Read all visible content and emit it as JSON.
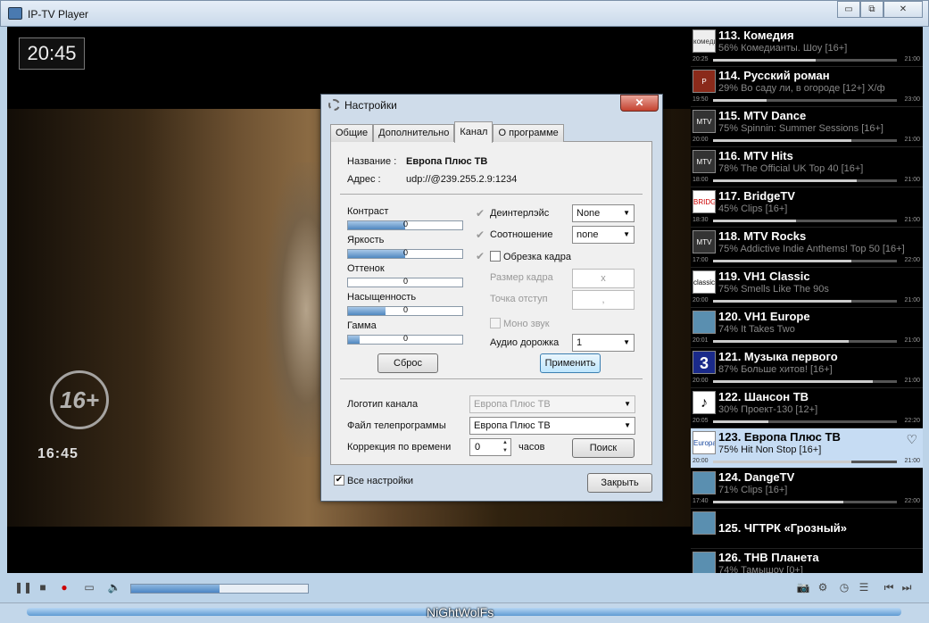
{
  "window": {
    "title": "IP-TV Player",
    "buttons": [
      "▭",
      "⧉",
      "✕"
    ]
  },
  "video": {
    "clock": "20:45",
    "age_rating": "16+",
    "overlay_time": "16:45"
  },
  "channels": [
    {
      "name": "113. Комедия",
      "program": "56% Комедианты. Шоу [16+]",
      "start": "20:25",
      "end": "21:00",
      "progress": 56,
      "logo": "комедия"
    },
    {
      "name": "114. Русский роман",
      "program": "29% Во саду ли, в огороде [12+] Х/ф",
      "start": "19:50",
      "end": "23:00",
      "progress": 29,
      "logo": "P"
    },
    {
      "name": "115. MTV Dance",
      "program": "75% Spinnin: Summer Sessions [16+]",
      "start": "20:00",
      "end": "21:00",
      "progress": 75,
      "logo": "MTV"
    },
    {
      "name": "116. MTV Hits",
      "program": "78% The Official UK Top 40 [16+]",
      "start": "18:00",
      "end": "21:00",
      "progress": 78,
      "logo": "MTV"
    },
    {
      "name": "117. BridgeTV",
      "program": "45% Clips [16+]",
      "start": "18:30",
      "end": "21:00",
      "progress": 45,
      "logo": "BRIDGE"
    },
    {
      "name": "118. MTV Rocks",
      "program": "75% Addictive Indie Anthems! Top 50 [16+]",
      "start": "17:00",
      "end": "22:00",
      "progress": 75,
      "logo": "MTV"
    },
    {
      "name": "119. VH1 Classic",
      "program": "75% Smells Like The 90s",
      "start": "20:00",
      "end": "21:00",
      "progress": 75,
      "logo": "classic"
    },
    {
      "name": "120. VH1 Europe",
      "program": "74% It Takes Two",
      "start": "20:01",
      "end": "21:00",
      "progress": 74,
      "logo": ""
    },
    {
      "name": "121. Музыка первого",
      "program": "87% Больше хитов! [16+]",
      "start": "20:00",
      "end": "21:00",
      "progress": 87,
      "logo": "3"
    },
    {
      "name": "122. Шансон ТВ",
      "program": "30% Проект-130 [12+]",
      "start": "20:05",
      "end": "22:20",
      "progress": 30,
      "logo": "♪"
    },
    {
      "name": "123. Европа Плюс ТВ",
      "program": "75% Hit Non Stop [16+]",
      "start": "20:00",
      "end": "21:00",
      "progress": 75,
      "logo": "Europa"
    },
    {
      "name": "124. DangeTV",
      "program": "71% Clips [16+]",
      "start": "17:40",
      "end": "22:00",
      "progress": 71,
      "logo": ""
    },
    {
      "name": "125. ЧГТРК «Грозный»",
      "program": "",
      "start": "",
      "end": "",
      "progress": 0,
      "logo": ""
    },
    {
      "name": "126. ТНВ Планета",
      "program": "74% Тамышоу [0+]",
      "start": "",
      "end": "",
      "progress": 74,
      "logo": ""
    }
  ],
  "selected_channel_index": 10,
  "controls": {
    "seek_progress": 50,
    "icons": [
      "pause-icon",
      "stop-icon",
      "record-icon",
      "folder-icon",
      "volume-icon",
      "camera-icon",
      "settings-icon",
      "clock-icon",
      "playlist-icon",
      "prev-icon",
      "next-icon"
    ]
  },
  "status": {
    "nickname": "NiGhtWolFs"
  },
  "dialog": {
    "title": "Настройки",
    "close": "✕",
    "tabs": [
      "Общие",
      "Дополнительно",
      "Канал",
      "О программе"
    ],
    "active_tab": 2,
    "name_label": "Название :",
    "name_value": "Европа Плюс ТВ",
    "address_label": "Адрес :",
    "address_value": "udp://@239.255.2.9:1234",
    "sliders": [
      {
        "label": "Контраст",
        "value": "0",
        "fill": 50
      },
      {
        "label": "Яркость",
        "value": "0",
        "fill": 50
      },
      {
        "label": "Оттенок",
        "value": "0",
        "fill": 0
      },
      {
        "label": "Насыщенность",
        "value": "0",
        "fill": 33
      },
      {
        "label": "Гамма",
        "value": "0",
        "fill": 10
      }
    ],
    "reset_button": "Сброс",
    "apply_button": "Применить",
    "deinterlace_label": "Деинтерлэйс",
    "deinterlace_value": "None",
    "aspect_label": "Соотношение",
    "aspect_value": "none",
    "crop_label": "Обрезка кадра",
    "frame_size_label": "Размер кадра",
    "frame_size_value": "x",
    "offset_label": "Точка отступ",
    "offset_value": ",",
    "mono_label": "Моно звук",
    "audio_label": "Аудио дорожка",
    "audio_value": "1",
    "logo_label": "Логотип канала",
    "logo_value": "Европа Плюс ТВ",
    "epg_label": "Файл телепрограммы",
    "epg_value": "Европа Плюс ТВ",
    "timecorr_label": "Коррекция по времени",
    "timecorr_value": "0",
    "hours_label": "часов",
    "search_button": "Поиск",
    "all_settings_label": "Все настройки",
    "all_settings_checked": "✔",
    "close_button": "Закрыть"
  }
}
